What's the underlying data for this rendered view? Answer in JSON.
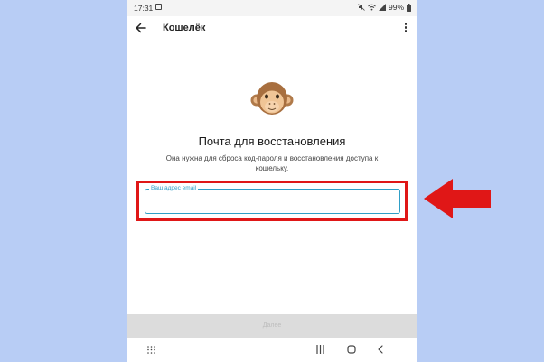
{
  "status_bar": {
    "time": "17:31",
    "battery": "99%"
  },
  "app_bar": {
    "title": "Кошелёк"
  },
  "main": {
    "heading": "Почта для восстановления",
    "description": "Она нужна для сброса код-пароля и восстановления доступа к кошельку.",
    "email_field": {
      "label": "Ваш адрес email",
      "value": ""
    }
  },
  "footer": {
    "next_label": "Далее"
  },
  "icons": {
    "back": "arrow-left-icon",
    "more": "more-vertical-icon",
    "monkey": "monkey-emoji-icon",
    "nav": [
      "apps-grid-icon",
      "recent-apps-icon",
      "home-icon",
      "back-chevron-icon"
    ]
  },
  "colors": {
    "accent": "#2f9fc7",
    "highlight": "#e01717",
    "background": "#b8cdf5"
  }
}
